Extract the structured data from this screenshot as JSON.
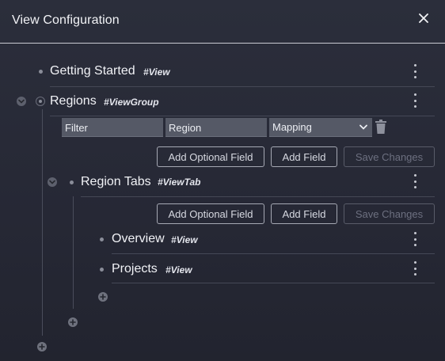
{
  "header": {
    "title": "View Configuration"
  },
  "tree": {
    "getting_started": {
      "label": "Getting Started",
      "tag": "#View"
    },
    "regions": {
      "label": "Regions",
      "tag": "#ViewGroup",
      "fields": {
        "filter": "Filter",
        "region": "Region",
        "mapping": "Mapping"
      }
    },
    "region_tabs": {
      "label": "Region Tabs",
      "tag": "#ViewTab"
    },
    "overview": {
      "label": "Overview",
      "tag": "#View"
    },
    "projects": {
      "label": "Projects",
      "tag": "#View"
    }
  },
  "actions": {
    "add_optional_field": "Add Optional Field",
    "add_field": "Add Field",
    "save_changes": "Save Changes"
  }
}
